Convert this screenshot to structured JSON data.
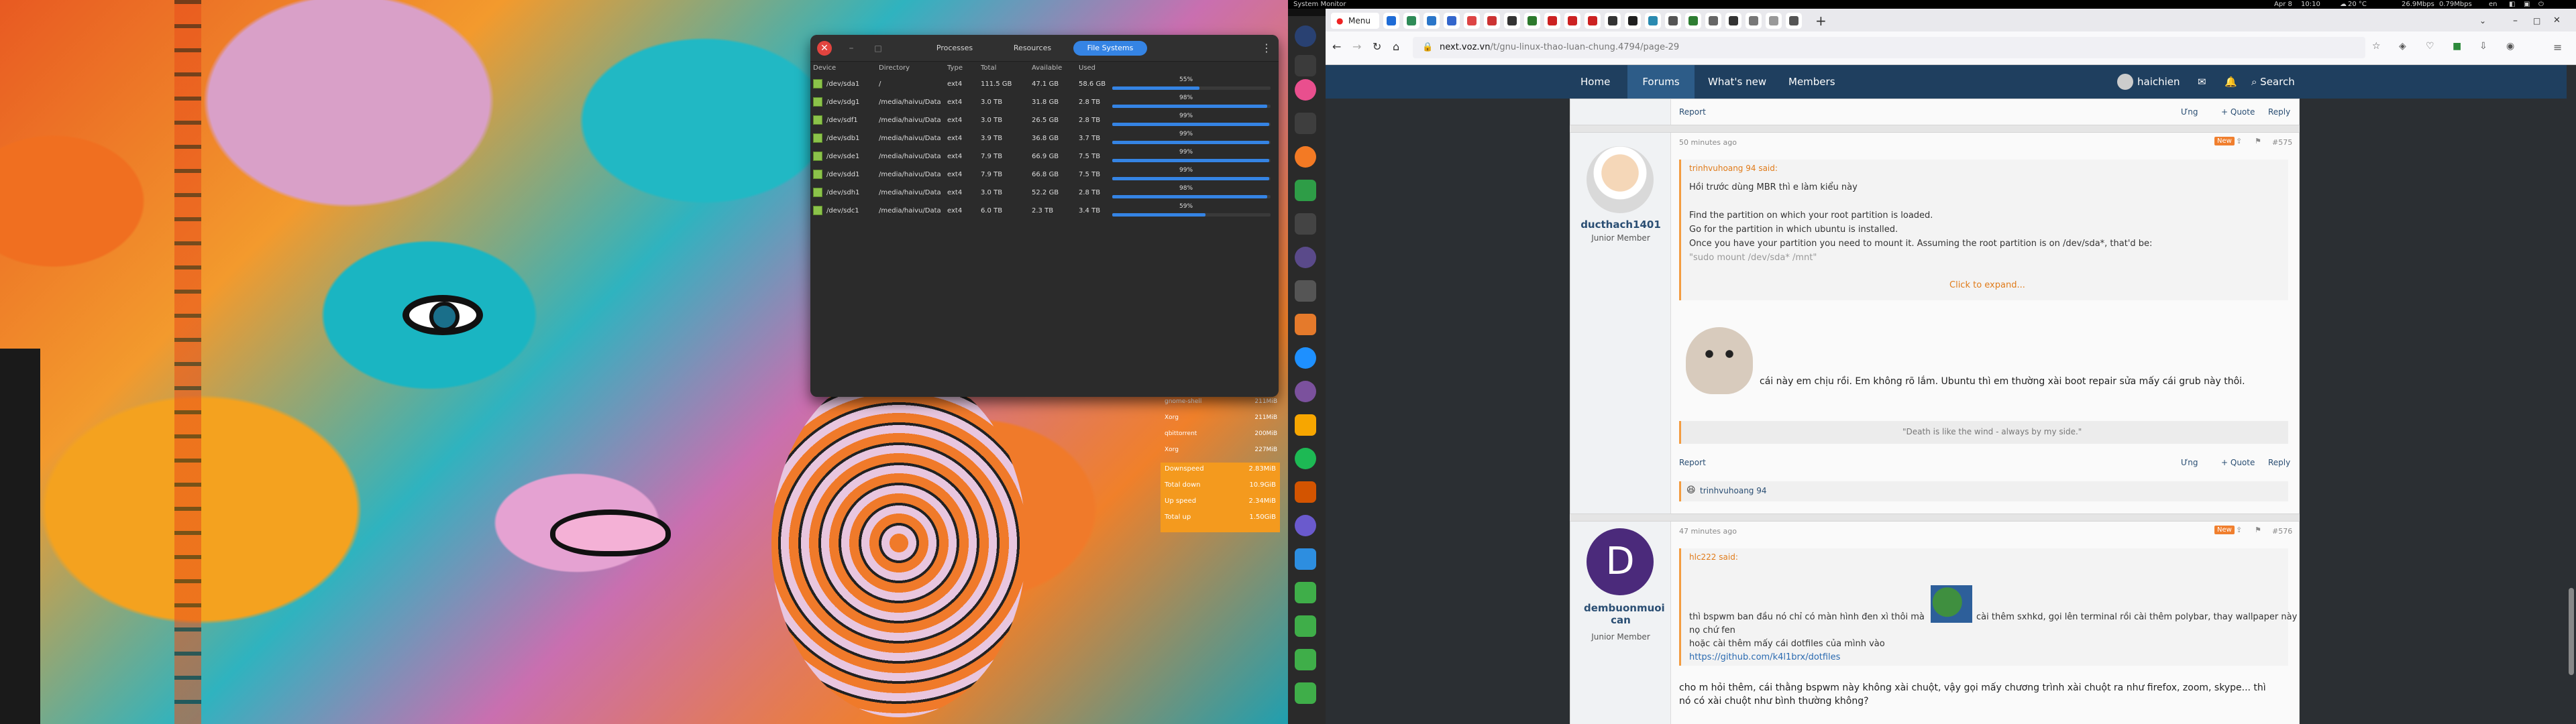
{
  "topbar": {
    "app": "System Monitor",
    "date": "Apr 8",
    "time": "10:10",
    "weather": "20 °C",
    "net_down": "26.9Mbps",
    "net_up": "0.79Mbps",
    "lang": "en"
  },
  "sysmon": {
    "tabs": [
      "Processes",
      "Resources",
      "File Systems"
    ],
    "columns": [
      "Device",
      "Directory",
      "Type",
      "Total",
      "Available",
      "Used"
    ],
    "rows": [
      {
        "device": "/dev/sda1",
        "dir": "/",
        "type": "ext4",
        "total": "111.5 GB",
        "avail": "47.1 GB",
        "used": "58.6 GB",
        "pct": "55%",
        "frac": 0.55
      },
      {
        "device": "/dev/sdg1",
        "dir": "/media/haivu/Data",
        "type": "ext4",
        "total": "3.0 TB",
        "avail": "31.8 GB",
        "used": "2.8 TB",
        "pct": "98%",
        "frac": 0.98
      },
      {
        "device": "/dev/sdf1",
        "dir": "/media/haivu/Data",
        "type": "ext4",
        "total": "3.0 TB",
        "avail": "26.5 GB",
        "used": "2.8 TB",
        "pct": "99%",
        "frac": 0.99
      },
      {
        "device": "/dev/sdb1",
        "dir": "/media/haivu/Data",
        "type": "ext4",
        "total": "3.9 TB",
        "avail": "36.8 GB",
        "used": "3.7 TB",
        "pct": "99%",
        "frac": 0.99
      },
      {
        "device": "/dev/sde1",
        "dir": "/media/haivu/Data",
        "type": "ext4",
        "total": "7.9 TB",
        "avail": "66.9 GB",
        "used": "7.5 TB",
        "pct": "99%",
        "frac": 0.99
      },
      {
        "device": "/dev/sdd1",
        "dir": "/media/haivu/Data",
        "type": "ext4",
        "total": "7.9 TB",
        "avail": "66.8 GB",
        "used": "7.5 TB",
        "pct": "99%",
        "frac": 0.99
      },
      {
        "device": "/dev/sdh1",
        "dir": "/media/haivu/Data",
        "type": "ext4",
        "total": "3.0 TB",
        "avail": "52.2 GB",
        "used": "2.8 TB",
        "pct": "98%",
        "frac": 0.98
      },
      {
        "device": "/dev/sdc1",
        "dir": "/media/haivu/Data",
        "type": "ext4",
        "total": "6.0 TB",
        "avail": "2.3 TB",
        "used": "3.4 TB",
        "pct": "59%",
        "frac": 0.59
      }
    ]
  },
  "conky": {
    "procs": [
      {
        "k": "gnome-shell",
        "v": "211MiB"
      },
      {
        "k": "Xorg",
        "v": "211MiB"
      },
      {
        "k": "qbittorrent",
        "v": "200MiB"
      },
      {
        "k": "Xorg",
        "v": "227MiB"
      }
    ],
    "totals": [
      {
        "k": "Downspeed",
        "v": "2.83MiB"
      },
      {
        "k": "Total down",
        "v": "10.9GiB"
      },
      {
        "k": "Up speed",
        "v": "2.34MiB"
      },
      {
        "k": "Total up",
        "v": "1.50GiB"
      }
    ]
  },
  "browser": {
    "menu_tab": "Menu",
    "url_host": "next.voz.vn",
    "url_path": "/t/gnu-linux-thao-luan-chung.4794/page-29",
    "nav": {
      "home": "Home",
      "forums": "Forums",
      "whats_new": "What's new",
      "members": "Members",
      "user": "haichien",
      "search": "Search"
    },
    "actions": {
      "report": "Report",
      "like": "Ưng",
      "quote": "+ Quote",
      "reply": "Reply"
    },
    "post1": {
      "time": "50 minutes ago",
      "badge": "New",
      "num": "#575",
      "author": "ducthach1401",
      "author_title": "Junior Member",
      "quote_head": "trinhvuhoang 94 said:",
      "quote_lines": [
        "Hồi trước dùng MBR thì e làm kiểu này",
        "",
        "Find the partition on which your root partition is loaded.",
        "Go for the partition in which ubuntu is installed.",
        "Once you have your partition you need to mount it. Assuming the root partition is on /dev/sda*, that'd be:",
        "\"sudo mount /dev/sda* /mnt\""
      ],
      "expand": "Click to expand...",
      "body": "cái này em chịu rồi. Em không rõ lắm. Ubuntu thì em thường xài boot repair sửa mấy cái grub này thôi.",
      "signature": "\"Death is like the wind - always by my side.\"",
      "reaction": "trinhvuhoang 94"
    },
    "post2": {
      "time": "47 minutes ago",
      "badge": "New",
      "num": "#576",
      "author": "dembuonmuoi can",
      "author_title": "Junior Member",
      "avatar_letter": "D",
      "quote_head": "hlc222 said:",
      "quote_line1a": "thì bspwm ban đầu nó chỉ có màn hình đen xì thôi mà",
      "quote_line1b": "cài thêm sxhkd, gọi lên terminal rồi cài thêm polybar, thay wallpaper này",
      "quote_line2": "nọ chứ fen",
      "quote_line3": "hoặc cài thêm mấy cái dotfiles của mình vào",
      "quote_link": "https://github.com/k4l1brx/dotfiles",
      "body1": "cho m hỏi thêm, cái thằng bspwm này không xài chuột, vậy gọi mấy chương trình xài chuột ra như firefox, zoom, skype... thì",
      "body2": "nó có xài chuột như bình thường không?"
    }
  }
}
